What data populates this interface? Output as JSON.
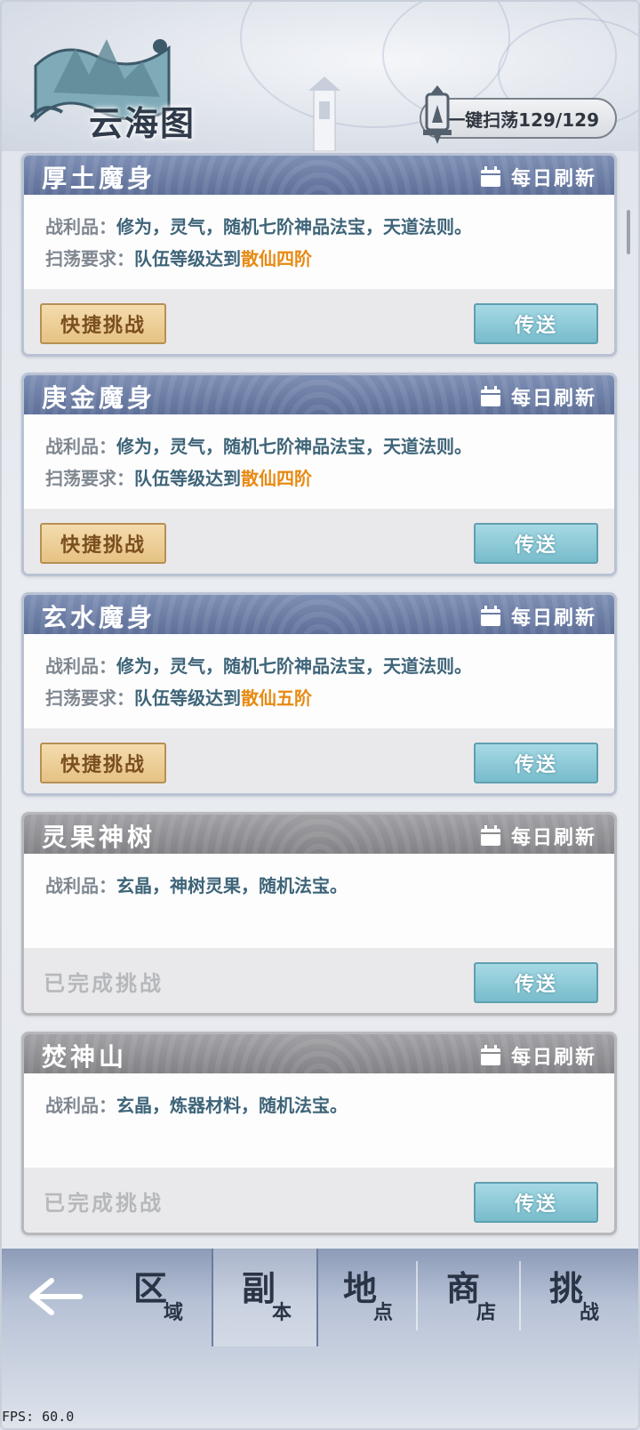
{
  "header": {
    "title": "云海图",
    "sweep_label": "一键扫荡129/129"
  },
  "labels": {
    "loot_label": "战利品：",
    "req_label": "扫荡要求："
  },
  "cards": [
    {
      "name": "厚土魔身",
      "refresh": "每日刷新",
      "loot": "修为，灵气，随机七阶神品法宝，天道法则。",
      "req_text": "队伍等级达到",
      "req_level": "散仙四阶",
      "action": "快捷挑战",
      "teleport": "传送",
      "completed": false
    },
    {
      "name": "庚金魔身",
      "refresh": "每日刷新",
      "loot": "修为，灵气，随机七阶神品法宝，天道法则。",
      "req_text": "队伍等级达到",
      "req_level": "散仙四阶",
      "action": "快捷挑战",
      "teleport": "传送",
      "completed": false
    },
    {
      "name": "玄水魔身",
      "refresh": "每日刷新",
      "loot": "修为，灵气，随机七阶神品法宝，天道法则。",
      "req_text": "队伍等级达到",
      "req_level": "散仙五阶",
      "action": "快捷挑战",
      "teleport": "传送",
      "completed": false
    },
    {
      "name": "灵果神树",
      "refresh": "每日刷新",
      "loot": "玄晶，神树灵果，随机法宝。",
      "action": "已完成挑战",
      "teleport": "传送",
      "completed": true
    },
    {
      "name": "焚神山",
      "refresh": "每日刷新",
      "loot": "玄晶，炼器材料，随机法宝。",
      "action": "已完成挑战",
      "teleport": "传送",
      "completed": true
    }
  ],
  "nav": {
    "items": [
      {
        "big": "区",
        "small": "域"
      },
      {
        "big": "副",
        "small": "本",
        "active": true
      },
      {
        "big": "地",
        "small": "点"
      },
      {
        "big": "商",
        "small": "店"
      },
      {
        "big": "挑",
        "small": "战"
      }
    ]
  },
  "fps": "FPS: 60.0",
  "colors": {
    "accent_orange": "#e88a12",
    "value_teal": "#3e6478",
    "header_blue": "#6a7ba4",
    "teleport_blue": "#8ccbd8",
    "quick_gold": "#ecd09a"
  }
}
